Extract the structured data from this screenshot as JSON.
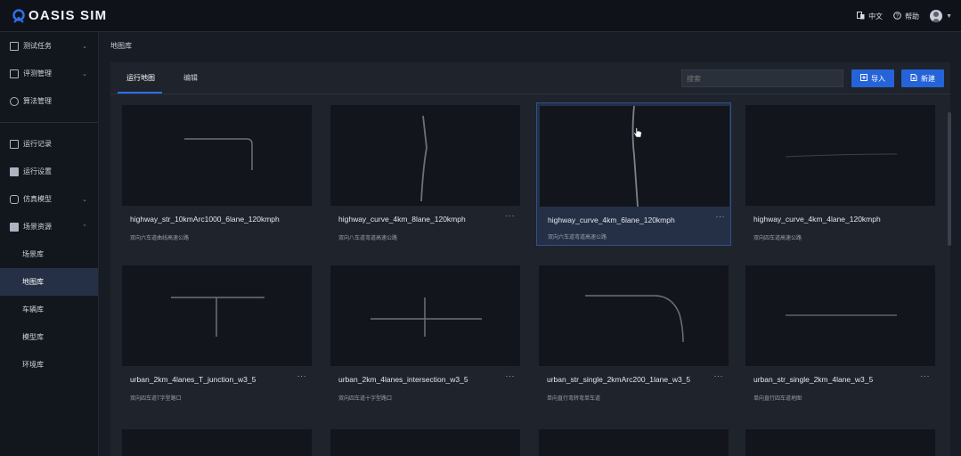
{
  "header": {
    "logo_text": "OASIS SIM",
    "language_label": "中文",
    "help_label": "帮助"
  },
  "sidebar": {
    "items": [
      {
        "label": "测试任务",
        "icon": "task-icon",
        "expandable": true
      },
      {
        "label": "评测管理",
        "icon": "evaluation-icon",
        "expandable": true
      },
      {
        "label": "算法管理",
        "icon": "algorithm-icon",
        "expandable": false
      },
      {
        "label": "运行记录",
        "icon": "record-icon",
        "expandable": false
      },
      {
        "label": "运行设置",
        "icon": "settings-icon",
        "expandable": false
      },
      {
        "label": "仿真模型",
        "icon": "model-icon",
        "expandable": true
      },
      {
        "label": "场景资源",
        "icon": "resource-icon",
        "expandable": true
      }
    ],
    "sub_items": [
      {
        "label": "场景库",
        "active": false
      },
      {
        "label": "地图库",
        "active": true
      },
      {
        "label": "车辆库",
        "active": false
      },
      {
        "label": "模型库",
        "active": false
      },
      {
        "label": "环境库",
        "active": false
      }
    ]
  },
  "main": {
    "breadcrumb": "地图库",
    "tabs": [
      {
        "label": "运行地图",
        "active": true
      },
      {
        "label": "编辑",
        "active": false
      }
    ],
    "search_placeholder": "搜索",
    "import_label": "导入",
    "new_label": "新建",
    "more_label": "···",
    "cards": [
      {
        "name": "highway_str_10kmArc1000_6lane_120kmph",
        "desc": "双向六车道曲线高速公路",
        "shape": "corner",
        "active": false
      },
      {
        "name": "highway_curve_4km_8lane_120kmph",
        "desc": "双向八车道弯道高速公路",
        "shape": "vcurve",
        "active": false
      },
      {
        "name": "highway_curve_4km_6lane_120kmph",
        "desc": "双向六车道弯道高速公路",
        "shape": "vcurve2",
        "active": true
      },
      {
        "name": "highway_curve_4km_4lane_120kmph",
        "desc": "双向四车道高速公路",
        "shape": "hline_faint",
        "active": false
      },
      {
        "name": "urban_2km_4lanes_T_junction_w3_5",
        "desc": "双向四车道T字型路口",
        "shape": "tjunction",
        "active": false
      },
      {
        "name": "urban_2km_4lanes_intersection_w3_5",
        "desc": "双向四车道十字型路口",
        "shape": "cross",
        "active": false
      },
      {
        "name": "urban_str_single_2kmArc200_1lane_w3_5",
        "desc": "单向直行弯转弯单车道",
        "shape": "arc",
        "active": false
      },
      {
        "name": "urban_str_single_2km_4lane_w3_5",
        "desc": "单向直行四车道地图",
        "shape": "hline",
        "active": false
      }
    ]
  }
}
